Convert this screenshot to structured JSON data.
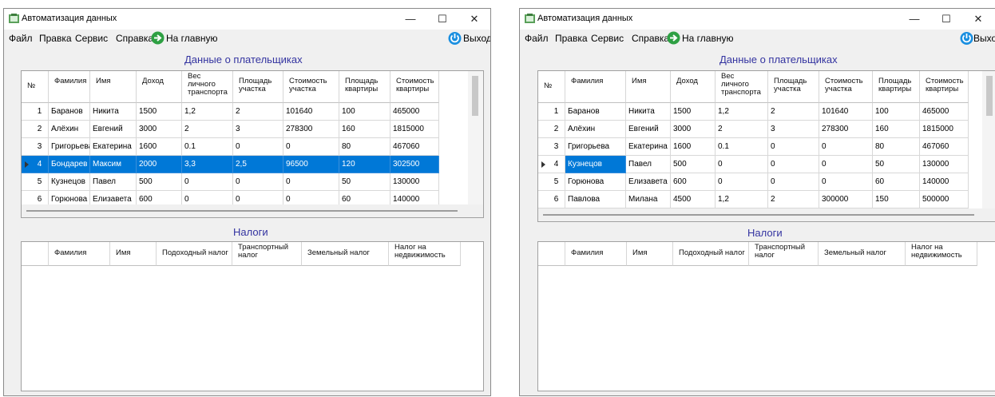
{
  "windows": [
    {
      "title": "Автоматизация данных",
      "menu": [
        "Файл",
        "Правка",
        "Сервис",
        "Справка"
      ],
      "home_label": "На главную",
      "exit_label": "Выход",
      "payers_title": "Данные о плательщиках",
      "taxes_title": "Налоги",
      "payers_columns": [
        "№",
        "Фамилия",
        "Имя",
        "Доход",
        "Вес\nличного\nтранспорта",
        "Площадь\nучастка",
        "Стоимость\nучастка",
        "Площадь\nквартиры",
        "Стоимость\nквартиры"
      ],
      "payers_rows": [
        [
          "1",
          "Баранов",
          "Никита",
          "1500",
          "1,2",
          "2",
          "101640",
          "100",
          "465000"
        ],
        [
          "2",
          "Алёхин",
          "Евгений",
          "3000",
          "2",
          "3",
          "278300",
          "160",
          "1815000"
        ],
        [
          "3",
          "Григорьева",
          "Екатерина",
          "1600",
          "0.1",
          "0",
          "0",
          "80",
          "467060"
        ],
        [
          "4",
          "Бондарев",
          "Максим",
          "2000",
          "3,3",
          "2,5",
          "96500",
          "120",
          "302500"
        ],
        [
          "5",
          "Кузнецов",
          "Павел",
          "500",
          "0",
          "0",
          "0",
          "50",
          "130000"
        ],
        [
          "6",
          "Горюнова",
          "Елизавета",
          "600",
          "0",
          "0",
          "0",
          "60",
          "140000"
        ]
      ],
      "selected_row": 3,
      "taxes_columns": [
        "",
        "Фамилия",
        "Имя",
        "Подоходный налог",
        "Транспортный\nналог",
        "Земельный налог",
        "Налог на\nнедвижимость"
      ]
    },
    {
      "title": "Автоматизация данных",
      "menu": [
        "Файл",
        "Правка",
        "Сервис",
        "Справка"
      ],
      "home_label": "На главную",
      "exit_label": "Выход",
      "payers_title": "Данные о плательщиках",
      "taxes_title": "Налоги",
      "payers_columns": [
        "№",
        "Фамилия",
        "Имя",
        "Доход",
        "Вес\nличного\nтранспорта",
        "Площадь\nучастка",
        "Стоимость\nучастка",
        "Площадь\nквартиры",
        "Стоимость\nквартиры"
      ],
      "payers_rows": [
        [
          "1",
          "Баранов",
          "Никита",
          "1500",
          "1,2",
          "2",
          "101640",
          "100",
          "465000"
        ],
        [
          "2",
          "Алёхин",
          "Евгений",
          "3000",
          "2",
          "3",
          "278300",
          "160",
          "1815000"
        ],
        [
          "3",
          "Григорьева",
          "Екатерина",
          "1600",
          "0.1",
          "0",
          "0",
          "80",
          "467060"
        ],
        [
          "4",
          "Кузнецов",
          "Павел",
          "500",
          "0",
          "0",
          "0",
          "50",
          "130000"
        ],
        [
          "5",
          "Горюнова",
          "Елизавета",
          "600",
          "0",
          "0",
          "0",
          "60",
          "140000"
        ],
        [
          "6",
          "Павлова",
          "Милана",
          "4500",
          "1,2",
          "2",
          "300000",
          "150",
          "500000"
        ]
      ],
      "selected_row": 3,
      "taxes_columns": [
        "",
        "Фамилия",
        "Имя",
        "Подоходный налог",
        "Транспортный\nналог",
        "Земельный налог",
        "Налог на\nнедвижимость"
      ]
    }
  ],
  "colors": {
    "selection": "#0078d7",
    "section_title": "#3333a0",
    "home_icon": "#2ea043",
    "exit_icon": "#1a8fe0"
  }
}
